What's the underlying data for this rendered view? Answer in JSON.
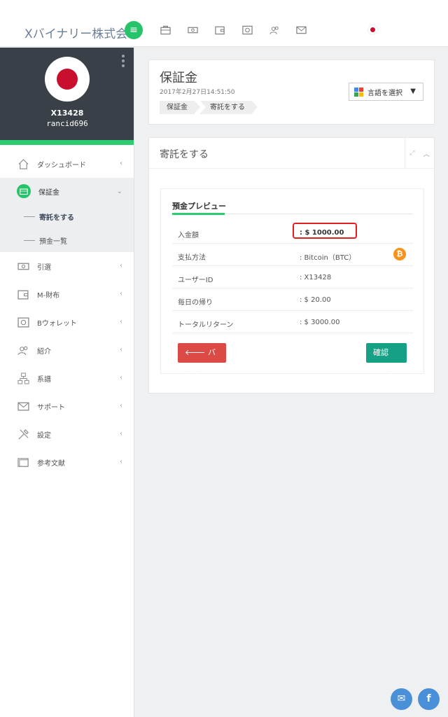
{
  "header": {
    "brand": "Xバイナリー株式会社",
    "icons": [
      "briefcase-icon",
      "money-icon",
      "wallet-icon",
      "safe-icon",
      "users-icon",
      "envelope-icon"
    ]
  },
  "profile": {
    "user_id": "X13428",
    "username": "rancid696"
  },
  "sidebar": {
    "items": [
      {
        "label": "ダッシュボード",
        "icon": "home-icon"
      },
      {
        "label": "保証金",
        "icon": "briefcase-icon"
      },
      {
        "label": "引選",
        "icon": "money-icon"
      },
      {
        "label": "M-財布",
        "icon": "wallet-icon"
      },
      {
        "label": "Bウォレット",
        "icon": "safe-icon"
      },
      {
        "label": "紹介",
        "icon": "users-icon"
      },
      {
        "label": "系譜",
        "icon": "sitemap-icon"
      },
      {
        "label": "サポート",
        "icon": "envelope-icon"
      },
      {
        "label": "設定",
        "icon": "tools-icon"
      },
      {
        "label": "参考文献",
        "icon": "folder-icon"
      }
    ],
    "subitems": [
      {
        "label": "寄託をする"
      },
      {
        "label": "預金一覧"
      }
    ]
  },
  "page": {
    "title": "保証金",
    "date": "2017年2月27日14:51:50",
    "breadcrumb": [
      "保証金",
      "寄託をする"
    ],
    "language_label": "言語を選択"
  },
  "panel": {
    "title": "寄託をする",
    "tab": "預金プレビュー",
    "rows": [
      {
        "key": "入金額",
        "value": ": $ 1000.00"
      },
      {
        "key": "支払方法",
        "value": ": Bitcoin（BTC）"
      },
      {
        "key": "ユーザーID",
        "value": ": X13428"
      },
      {
        "key": "毎日の帰り",
        "value": ": $ 20.00"
      },
      {
        "key": "トータルリターン",
        "value": ": $ 3000.00"
      }
    ],
    "back_label": "バック",
    "confirm_label": "確認"
  },
  "colors": {
    "accent": "#2ecc71",
    "danger": "#db4a45",
    "confirm": "#16a085",
    "sidebar_dark": "#3a4047",
    "bitcoin": "#f7931a"
  }
}
